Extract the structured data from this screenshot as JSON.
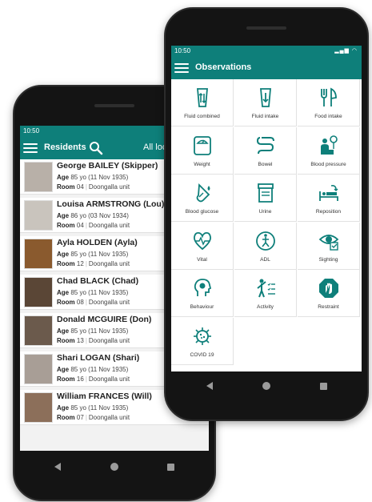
{
  "colors": {
    "primary": "#0e7f7a",
    "phone_body": "#141414"
  },
  "residents_screen": {
    "status_time": "10:50",
    "title": "Residents",
    "filter_label": "All loc",
    "residents": [
      {
        "name": "George BAILEY (Skipper)",
        "age_label": "Age",
        "age": "85 yo",
        "dob": "(11 Nov 1935)",
        "room_label": "Room",
        "room": "04",
        "unit": "Doongalla unit",
        "avatar_color": "#b8b0a8"
      },
      {
        "name": "Louisa ARMSTRONG (Lou)",
        "age_label": "Age",
        "age": "86 yo",
        "dob": "(03 Nov 1934)",
        "room_label": "Room",
        "room": "04",
        "unit": "Doongalla unit",
        "avatar_color": "#c9c4bd"
      },
      {
        "name": "Ayla HOLDEN (Ayla)",
        "age_label": "Age",
        "age": "85 yo",
        "dob": "(11 Nov 1935)",
        "room_label": "Room",
        "room": "12",
        "unit": "Doongalla unit",
        "avatar_color": "#8a5a2e"
      },
      {
        "name": "Chad BLACK (Chad)",
        "age_label": "Age",
        "age": "85 yo",
        "dob": "(11 Nov 1935)",
        "room_label": "Room",
        "room": "08",
        "unit": "Doongalla unit",
        "avatar_color": "#5a4636"
      },
      {
        "name": "Donald MCGUIRE (Don)",
        "age_label": "Age",
        "age": "85 yo",
        "dob": "(11 Nov 1935)",
        "room_label": "Room",
        "room": "13",
        "unit": "Doongalla unit",
        "avatar_color": "#6b5a4c"
      },
      {
        "name": "Shari LOGAN (Shari)",
        "age_label": "Age",
        "age": "85 yo",
        "dob": "(11 Nov 1935)",
        "room_label": "Room",
        "room": "16",
        "unit": "Doongalla unit",
        "avatar_color": "#a89e96"
      },
      {
        "name": "William FRANCES (Will)",
        "age_label": "Age",
        "age": "85 yo",
        "dob": "(11 Nov 1935)",
        "room_label": "Room",
        "room": "07",
        "unit": "Doongalla unit",
        "avatar_color": "#8c6f5a"
      }
    ]
  },
  "observations_screen": {
    "status_time": "10:50",
    "title": "Observations",
    "tiles": [
      {
        "label": "Fluid combined",
        "icon": "fluid-combined"
      },
      {
        "label": "Fluid intake",
        "icon": "fluid-intake"
      },
      {
        "label": "Food intake",
        "icon": "food-intake"
      },
      {
        "label": "Weight",
        "icon": "weight"
      },
      {
        "label": "Bowel",
        "icon": "bowel"
      },
      {
        "label": "Blood pressure",
        "icon": "blood-pressure"
      },
      {
        "label": "Blood glucose",
        "icon": "blood-glucose"
      },
      {
        "label": "Urine",
        "icon": "urine"
      },
      {
        "label": "Reposition",
        "icon": "reposition"
      },
      {
        "label": "Vital",
        "icon": "vital"
      },
      {
        "label": "ADL",
        "icon": "adl"
      },
      {
        "label": "Sighting",
        "icon": "sighting"
      },
      {
        "label": "Behaviour",
        "icon": "behaviour"
      },
      {
        "label": "Activity",
        "icon": "activity"
      },
      {
        "label": "Restraint",
        "icon": "restraint"
      },
      {
        "label": "COVID 19",
        "icon": "covid-19"
      }
    ]
  }
}
